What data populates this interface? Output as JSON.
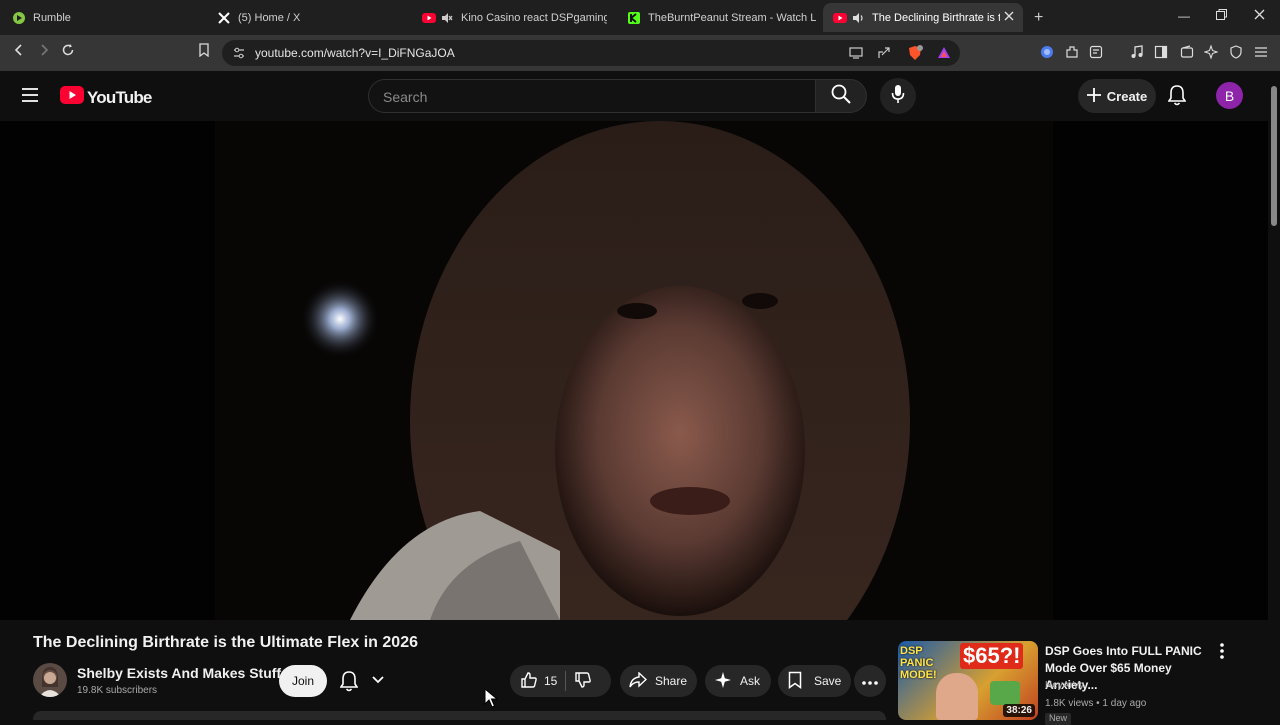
{
  "browser": {
    "tabs": [
      {
        "label": "Rumble",
        "icon": "rumble-icon"
      },
      {
        "label": "(5) Home / X",
        "icon": "x-icon"
      },
      {
        "label": "Kino Casino react DSPgamings W",
        "icon": "youtube-icon"
      },
      {
        "label": "TheBurntPeanut Stream - Watch Live",
        "icon": "kick-icon"
      },
      {
        "label": "The Declining Birthrate is the",
        "icon": "youtube-icon"
      }
    ],
    "url": "youtube.com/watch?v=I_DiFNGaJOA"
  },
  "header": {
    "logo_text": "YouTube",
    "search_placeholder": "Search",
    "create_label": "Create",
    "avatar_letter": "B"
  },
  "video": {
    "title": "The Declining Birthrate is the Ultimate Flex in 2026",
    "channel_name": "Shelby Exists And Makes Stuff",
    "subscribers": "19.8K subscribers",
    "join_label": "Join",
    "like_count": "15",
    "share_label": "Share",
    "ask_label": "Ask",
    "save_label": "Save"
  },
  "recommended": [
    {
      "title": "DSP Goes Into FULL PANIC Mode Over $65 Money Anxiety...",
      "channel": "HeyArVy",
      "meta": "1.8K views • 1 day ago",
      "duration": "38:26",
      "badge": "New",
      "thumb_text_1": "DSP PANIC MODE!",
      "thumb_text_2": "$65?!"
    }
  ],
  "colors": {
    "background": "#0f0f0f",
    "youtube_red": "#ff0033",
    "avatar": "#8e24aa",
    "kick_green": "#53fc18",
    "rumble_green": "#85c742"
  }
}
